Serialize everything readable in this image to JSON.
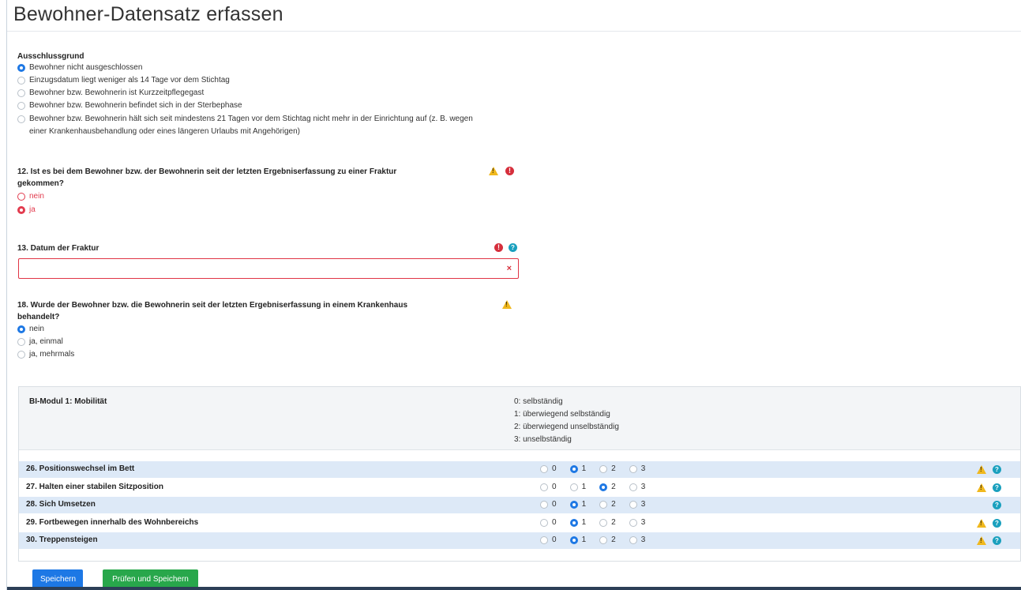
{
  "page": {
    "title": "Bewohner-Datensatz erfassen"
  },
  "exclusion": {
    "title": "Ausschlussgrund",
    "options": [
      "Bewohner nicht ausgeschlossen",
      "Einzugsdatum liegt weniger als 14 Tage vor dem Stichtag",
      "Bewohner bzw. Bewohnerin ist Kurzzeitpflegegast",
      "Bewohner bzw. Bewohnerin befindet sich in der Sterbephase",
      "Bewohner bzw. Bewohnerin hält sich seit mindestens 21 Tagen vor dem Stichtag nicht mehr in der Einrichtung auf (z. B. wegen",
      "einer Krankenhausbehandlung oder eines längeren Urlaubs mit Angehörigen)"
    ],
    "selected": 0
  },
  "q12": {
    "title_line1": "12. Ist es bei dem Bewohner bzw. der Bewohnerin seit der letzten Ergebniserfassung zu einer Fraktur",
    "title_line2": "gekommen?",
    "options": [
      "nein",
      "ja"
    ],
    "selected": 1
  },
  "q13": {
    "title": "13. Datum der Fraktur",
    "value": "",
    "clear_glyph": "×"
  },
  "q18": {
    "title_line1": "18. Wurde der Bewohner bzw. die Bewohnerin seit der letzten Ergebniserfassung in einem Krankenhaus",
    "title_line2": "behandelt?",
    "options": [
      "nein",
      "ja, einmal",
      "ja, mehrmals"
    ],
    "selected": 0
  },
  "module": {
    "title": "BI-Modul 1: Mobilität",
    "legend": [
      "0: selbständig",
      "1: überwiegend selbständig",
      "2: überwiegend unselbständig",
      "3: unselbständig"
    ],
    "scale": [
      "0",
      "1",
      "2",
      "3"
    ],
    "rows": [
      {
        "label": "26. Positionswechsel im Bett",
        "selected": 1,
        "warning": true
      },
      {
        "label": "27. Halten einer stabilen Sitzposition",
        "selected": 2,
        "warning": true
      },
      {
        "label": "28. Sich Umsetzen",
        "selected": 1,
        "warning": false
      },
      {
        "label": "29. Fortbewegen innerhalb des Wohnbereichs",
        "selected": 1,
        "warning": true
      },
      {
        "label": "30. Treppensteigen",
        "selected": 1,
        "warning": true
      }
    ]
  },
  "icons": {
    "warning": "!",
    "error": "!",
    "help": "?"
  },
  "buttons": {
    "save": "Speichern",
    "check_save": "Prüfen und Speichern"
  },
  "colors": {
    "primary": "#1d78e5",
    "success": "#28a74b",
    "error": "#d62f3c",
    "warning": "#f0b81d",
    "info": "#1aa0be"
  }
}
